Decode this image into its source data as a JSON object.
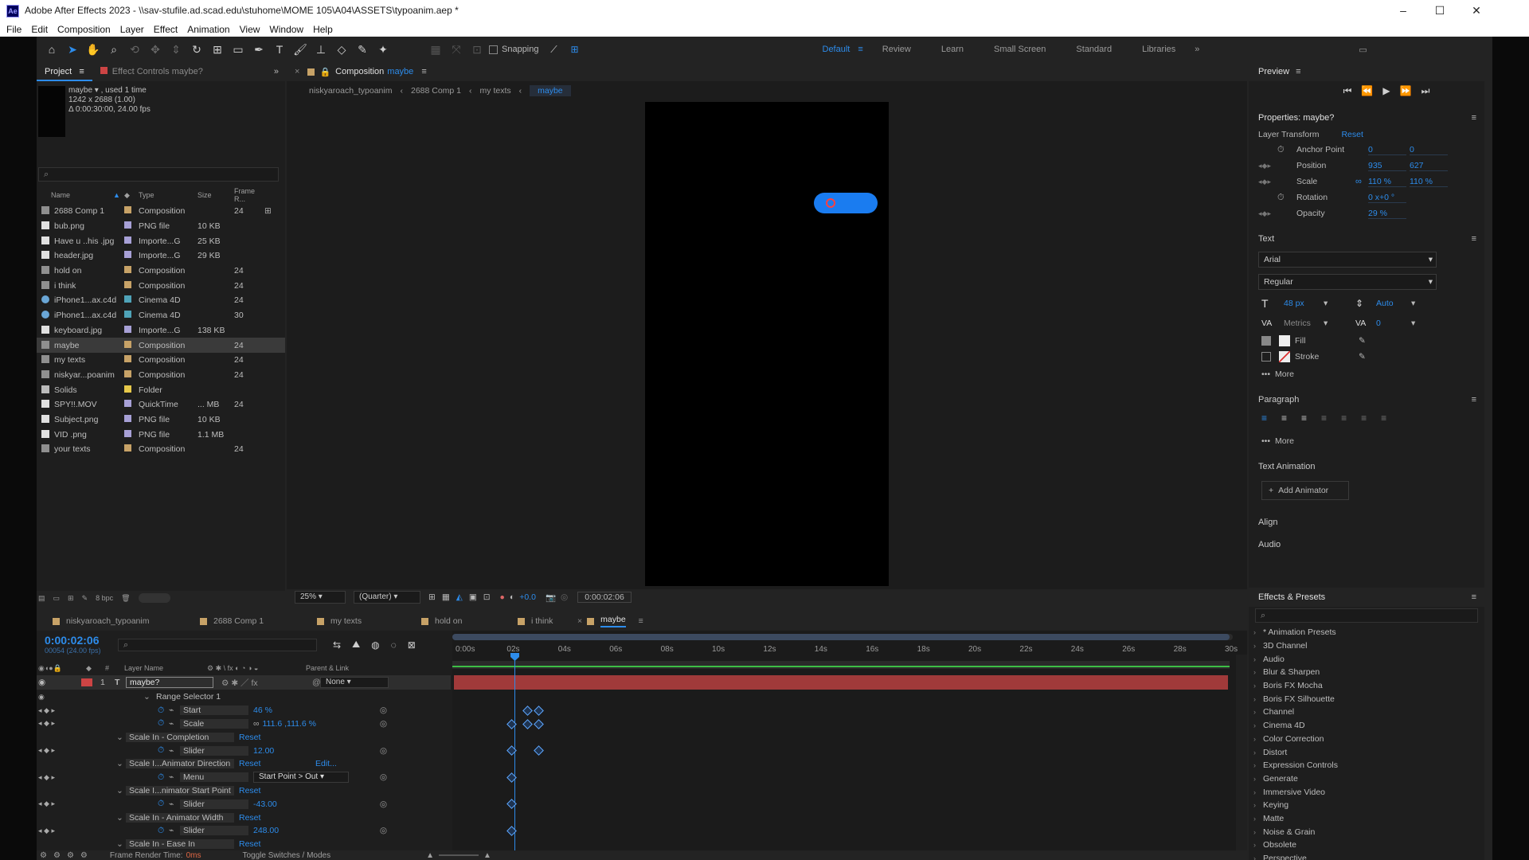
{
  "titlebar": {
    "app_icon": "Ae",
    "title": "Adobe After Effects 2023 - \\\\sav-stufile.ad.scad.edu\\stuhome\\MOME 105\\A04\\ASSETS\\typoanim.aep *"
  },
  "menu": [
    "File",
    "Edit",
    "Composition",
    "Layer",
    "Effect",
    "Animation",
    "View",
    "Window",
    "Help"
  ],
  "toolbar": {
    "snapping": "Snapping",
    "workspaces": [
      "Default",
      "Review",
      "Learn",
      "Small Screen",
      "Standard",
      "Libraries"
    ]
  },
  "project": {
    "tab_project": "Project",
    "tab_effect_controls": "Effect Controls maybe?",
    "info_name": "maybe",
    "info_used": ", used 1 time",
    "info_dims": "1242 x 2688 (1.00)",
    "info_duration": "Δ 0:00:30:00, 24.00 fps",
    "cols": {
      "name": "Name",
      "type": "Type",
      "size": "Size",
      "frame": "Frame R..."
    },
    "items": [
      {
        "name": "2688 Comp 1",
        "type": "Composition",
        "size": "",
        "fr": "24",
        "color": "#c7a267",
        "icon": "comp"
      },
      {
        "name": "bub.png",
        "type": "PNG file",
        "size": "10 KB",
        "fr": "",
        "color": "#a7a0d6",
        "icon": "file"
      },
      {
        "name": "Have u ..his .jpg",
        "type": "Importe...G",
        "size": "25 KB",
        "fr": "",
        "color": "#a7a0d6",
        "icon": "file"
      },
      {
        "name": "header.jpg",
        "type": "Importe...G",
        "size": "29 KB",
        "fr": "",
        "color": "#a7a0d6",
        "icon": "file"
      },
      {
        "name": "hold on",
        "type": "Composition",
        "size": "",
        "fr": "24",
        "color": "#c7a267",
        "icon": "comp"
      },
      {
        "name": "i think",
        "type": "Composition",
        "size": "",
        "fr": "24",
        "color": "#c7a267",
        "icon": "comp"
      },
      {
        "name": "iPhone1...ax.c4d",
        "type": "Cinema 4D",
        "size": "",
        "fr": "24",
        "color": "#4fa3b8",
        "icon": "c4d"
      },
      {
        "name": "iPhone1...ax.c4d",
        "type": "Cinema 4D",
        "size": "",
        "fr": "30",
        "color": "#4fa3b8",
        "icon": "c4d"
      },
      {
        "name": "keyboard.jpg",
        "type": "Importe...G",
        "size": "138 KB",
        "fr": "",
        "color": "#a7a0d6",
        "icon": "file"
      },
      {
        "name": "maybe",
        "type": "Composition",
        "size": "",
        "fr": "24",
        "color": "#c7a267",
        "icon": "comp",
        "sel": true
      },
      {
        "name": "my texts",
        "type": "Composition",
        "size": "",
        "fr": "24",
        "color": "#c7a267",
        "icon": "comp"
      },
      {
        "name": "niskyar...poanim",
        "type": "Composition",
        "size": "",
        "fr": "24",
        "color": "#c7a267",
        "icon": "comp"
      },
      {
        "name": "Solids",
        "type": "Folder",
        "size": "",
        "fr": "",
        "color": "#e6c84a",
        "icon": "folder"
      },
      {
        "name": "SPY!!.MOV",
        "type": "QuickTime",
        "size": "... MB",
        "fr": "24",
        "color": "#a7a0d6",
        "icon": "file"
      },
      {
        "name": "Subject.png",
        "type": "PNG file",
        "size": "10 KB",
        "fr": "",
        "color": "#a7a0d6",
        "icon": "file"
      },
      {
        "name": "VID .png",
        "type": "PNG file",
        "size": "1.1 MB",
        "fr": "",
        "color": "#a7a0d6",
        "icon": "file"
      },
      {
        "name": "your texts",
        "type": "Composition",
        "size": "",
        "fr": "24",
        "color": "#c7a267",
        "icon": "comp"
      }
    ],
    "bpc": "8 bpc"
  },
  "composition": {
    "tab_label": "Composition",
    "tab_name": "maybe",
    "breadcrumbs": [
      "niskyaroach_typoanim",
      "2688 Comp 1",
      "my texts",
      "maybe"
    ],
    "zoom": "25%",
    "quality": "(Quarter)",
    "exposure": "+0.0",
    "timecode": "0:00:02:06"
  },
  "preview": {
    "title": "Preview"
  },
  "properties": {
    "title": "Properties: maybe?",
    "layer_transform": "Layer Transform",
    "reset": "Reset",
    "rows": [
      {
        "label": "Anchor Point",
        "v1": "0",
        "v2": "0"
      },
      {
        "label": "Position",
        "v1": "935",
        "v2": "627"
      },
      {
        "label": "Scale",
        "v1": "110 %",
        "v2": "110 %"
      },
      {
        "label": "Rotation",
        "v1": "0 x+0 °",
        "v2": ""
      },
      {
        "label": "Opacity",
        "v1": "29 %",
        "v2": ""
      }
    ],
    "text_title": "Text",
    "font": "Arial",
    "style": "Regular",
    "size": "48 px",
    "leading": "Auto",
    "kerning": "Metrics",
    "tracking": "0",
    "fill": "Fill",
    "stroke": "Stroke",
    "more": "More",
    "paragraph_title": "Paragraph",
    "text_animation": "Text Animation",
    "add_animator": "Add Animator",
    "align": "Align",
    "audio": "Audio"
  },
  "effects": {
    "title": "Effects & Presets",
    "items": [
      "* Animation Presets",
      "3D Channel",
      "Audio",
      "Blur & Sharpen",
      "Boris FX Mocha",
      "Boris FX Silhouette",
      "Channel",
      "Cinema 4D",
      "Color Correction",
      "Distort",
      "Expression Controls",
      "Generate",
      "Immersive Video",
      "Keying",
      "Matte",
      "Noise & Grain",
      "Obsolete",
      "Perspective"
    ]
  },
  "timeline": {
    "tabs": [
      "niskyaroach_typoanim",
      "2688 Comp 1",
      "my texts",
      "hold on",
      "i think",
      "maybe"
    ],
    "timecode": "0:00:02:06",
    "frame_info": "00054 (24.00 fps)",
    "col_layer_name": "Layer Name",
    "col_parent": "Parent & Link",
    "layer_number": "1",
    "layer_name": "maybe?",
    "parent": "None",
    "ruler": [
      "0:00s",
      "02s",
      "04s",
      "06s",
      "08s",
      "10s",
      "12s",
      "14s",
      "16s",
      "18s",
      "20s",
      "22s",
      "24s",
      "26s",
      "28s",
      "30s"
    ],
    "rows": [
      {
        "indent": 2,
        "label": "Range Selector 1",
        "value": "",
        "type": "group"
      },
      {
        "indent": 4,
        "label": "Start",
        "value": "46 %",
        "type": "prop"
      },
      {
        "indent": 4,
        "label": "Scale",
        "value": "111.6 ,111.6 %",
        "type": "prop"
      },
      {
        "indent": 1,
        "label": "Scale In - Completion",
        "value": "Reset",
        "type": "effect"
      },
      {
        "indent": 4,
        "label": "Slider",
        "value": "12.00",
        "type": "prop"
      },
      {
        "indent": 1,
        "label": "Scale I...Animator Direction",
        "value": "Reset",
        "extra": "Edit...",
        "type": "effect"
      },
      {
        "indent": 4,
        "label": "Menu",
        "value": "Start Point > Out",
        "type": "menu"
      },
      {
        "indent": 1,
        "label": "Scale I...nimator Start Point",
        "value": "Reset",
        "type": "effect"
      },
      {
        "indent": 4,
        "label": "Slider",
        "value": "-43.00",
        "type": "prop"
      },
      {
        "indent": 1,
        "label": "Scale In - Animator Width",
        "value": "Reset",
        "type": "effect"
      },
      {
        "indent": 4,
        "label": "Slider",
        "value": "248.00",
        "type": "prop"
      },
      {
        "indent": 1,
        "label": "Scale In - Ease In",
        "value": "Reset",
        "type": "effect"
      }
    ],
    "status_render": "Frame Render Time:",
    "status_render_val": "0ms",
    "status_toggle": "Toggle Switches / Modes"
  },
  "colors": {
    "accent": "#2d8ceb",
    "layer_bar": "#a03a3a",
    "selection": "#2d8ceb"
  }
}
